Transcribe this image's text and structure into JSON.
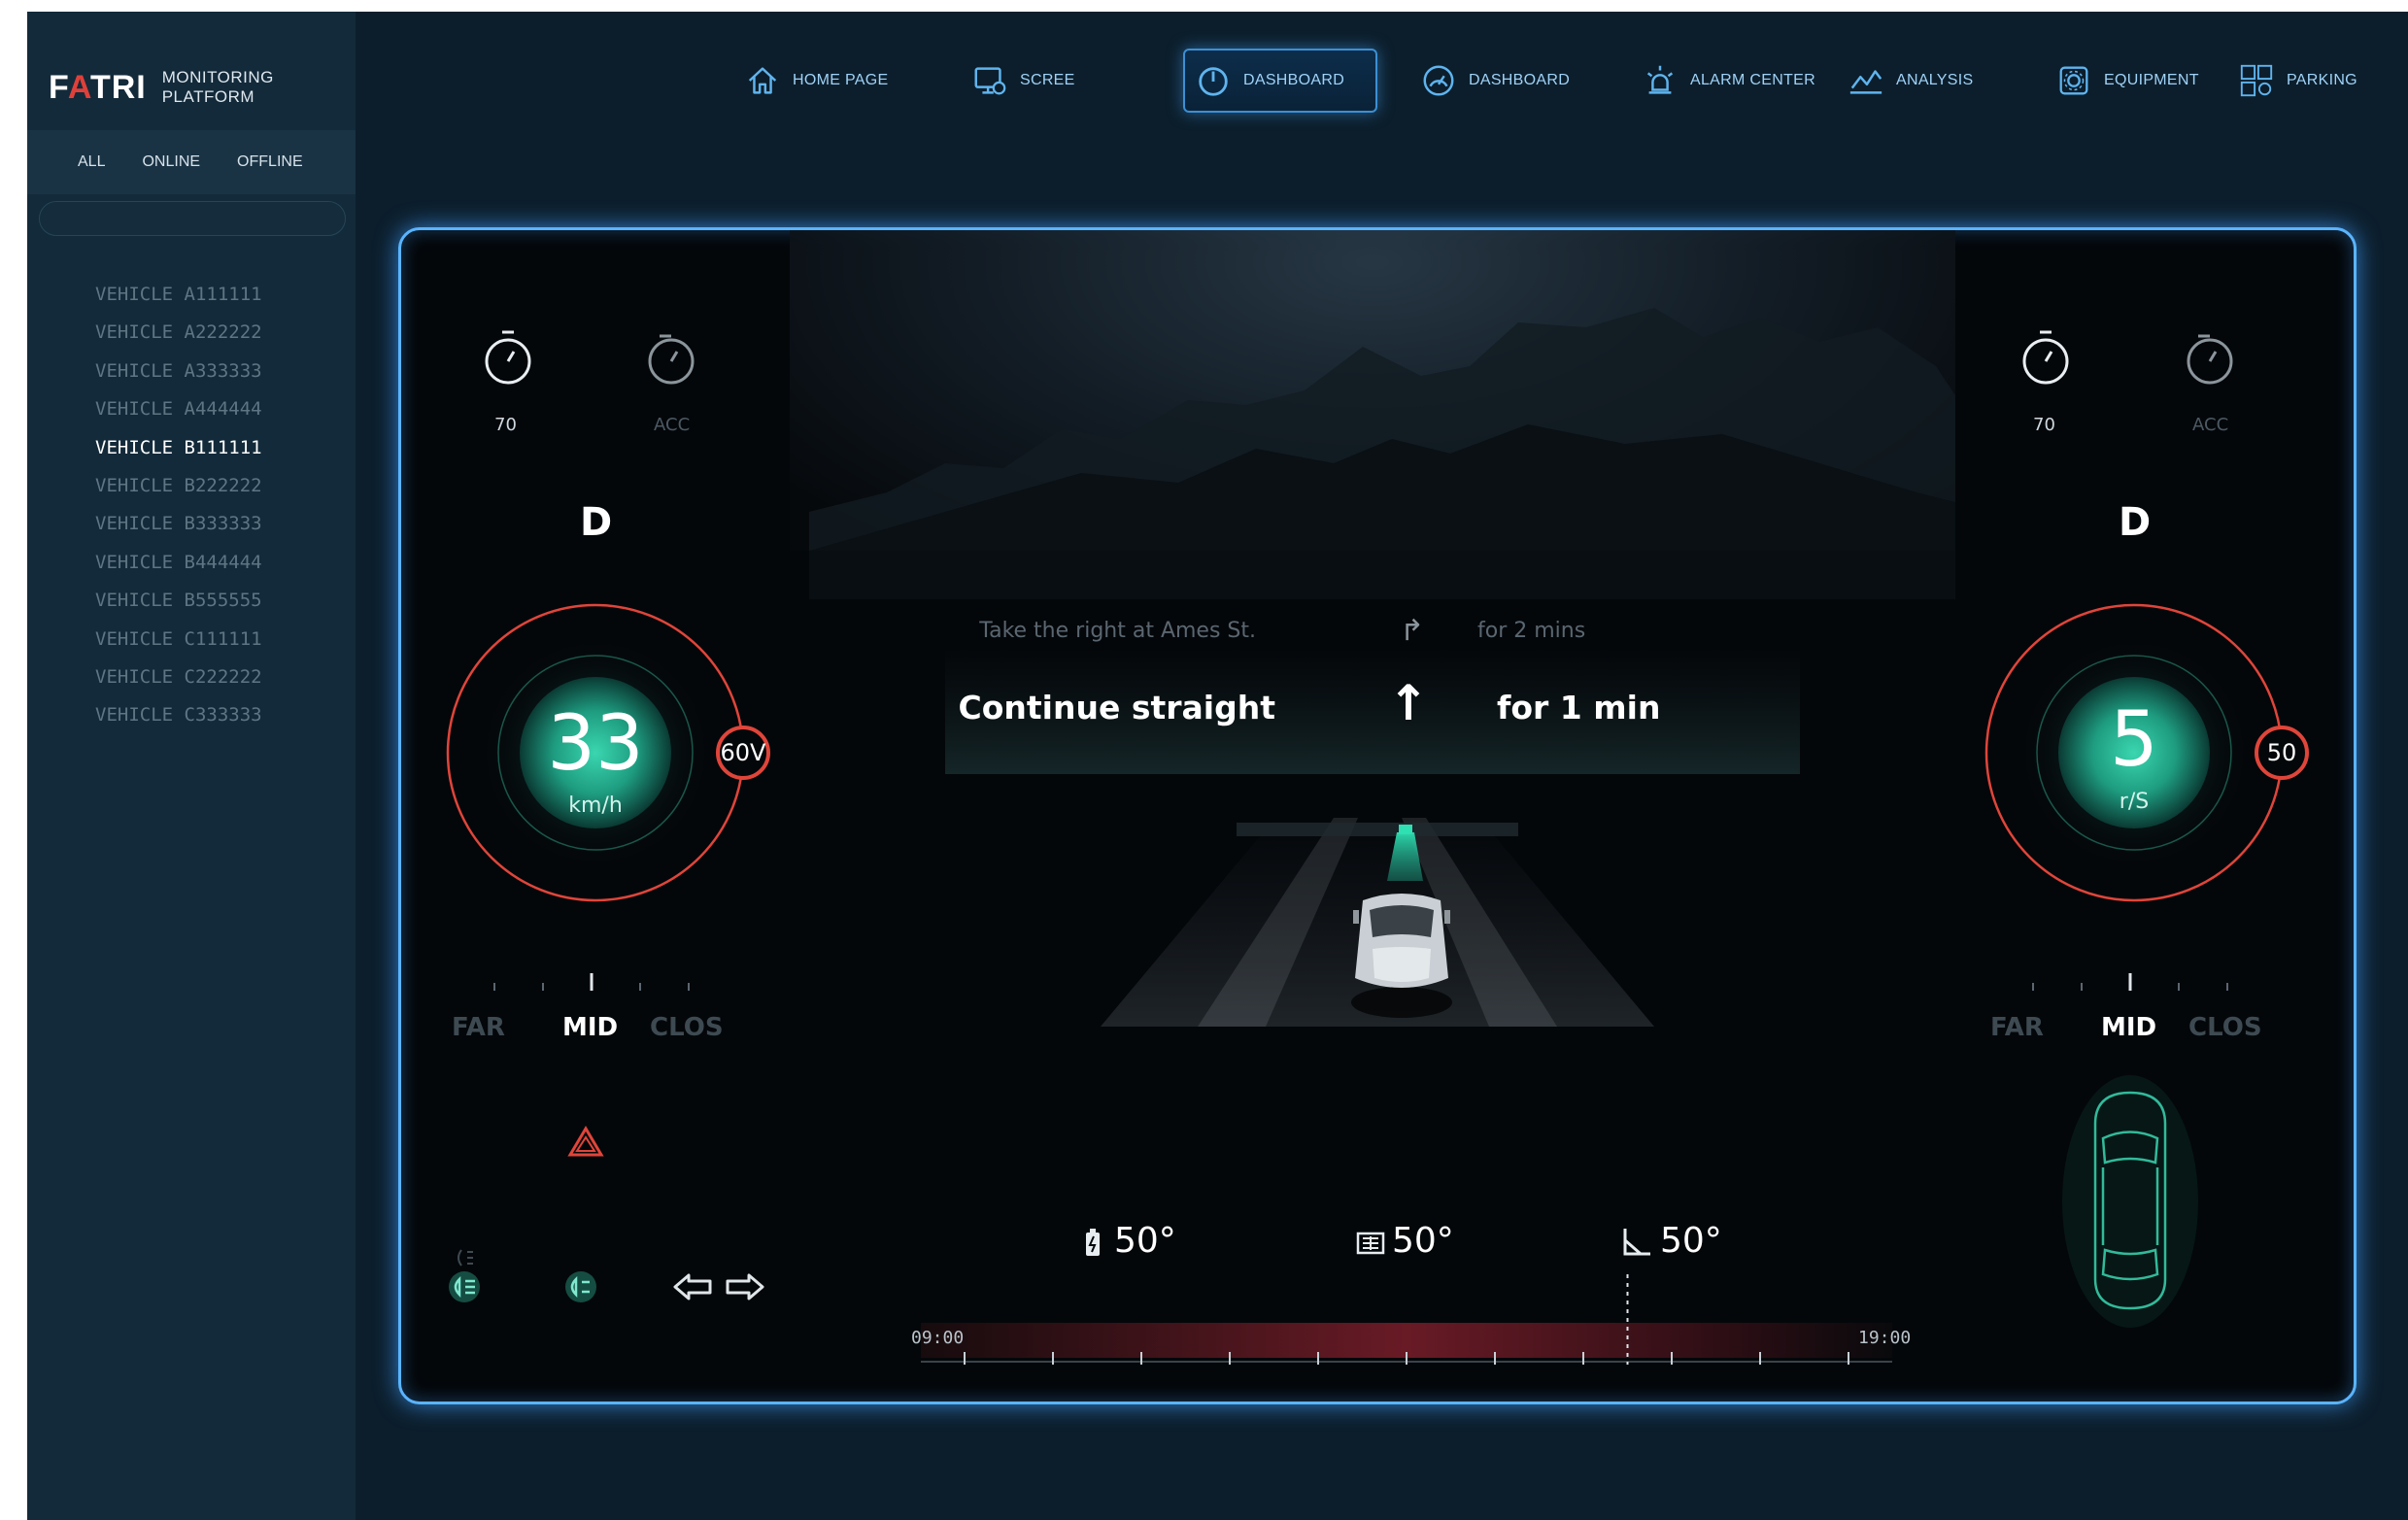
{
  "brand": {
    "logo_pre": "F",
    "logo_accent": "A",
    "logo_post": "TRI",
    "subtitle": "MONITORING PLATFORM"
  },
  "filters": [
    "ALL",
    "ONLINE",
    "OFFLINE"
  ],
  "vehicles": [
    "VEHICLE A111111",
    "VEHICLE A222222",
    "VEHICLE A333333",
    "VEHICLE A444444",
    "VEHICLE B111111",
    "VEHICLE B222222",
    "VEHICLE B333333",
    "VEHICLE B444444",
    "VEHICLE B555555",
    "VEHICLE C111111",
    "VEHICLE C222222",
    "VEHICLE C333333"
  ],
  "active_vehicle_index": 4,
  "nav": [
    {
      "label": "HOME PAGE",
      "icon": "home-icon"
    },
    {
      "label": "SCREE",
      "icon": "monitor-icon"
    },
    {
      "label": "DASHBOARD",
      "icon": "speedometer-icon",
      "active": true
    },
    {
      "label": "DASHBOARD",
      "icon": "gauge-icon"
    },
    {
      "label": "ALARM CENTER",
      "icon": "alarm-icon"
    },
    {
      "label": "ANALYSIS",
      "icon": "line-chart-icon"
    },
    {
      "label": "EQUIPMENT",
      "icon": "gear-icon"
    },
    {
      "label": "PARKING",
      "icon": "parking-icon"
    }
  ],
  "left_cluster": {
    "speed_limit": "70",
    "acc_label": "ACC",
    "gear": "D",
    "value": "33",
    "unit": "km/h",
    "badge": "60V",
    "dist": {
      "far": "FAR",
      "mid": "MID",
      "close": "CLOS"
    }
  },
  "right_cluster": {
    "speed_limit": "70",
    "acc_label": "ACC",
    "gear": "D",
    "value": "5",
    "unit": "r/S",
    "badge": "50",
    "dist": {
      "far": "FAR",
      "mid": "MID",
      "close": "CLOS"
    }
  },
  "navigation": {
    "next": {
      "text": "Take the right at Ames St.",
      "duration": "for 2 mins"
    },
    "current": {
      "text": "Continue straight",
      "duration": "for 1 min"
    }
  },
  "stats": [
    {
      "icon": "battery-icon",
      "value": "50°"
    },
    {
      "icon": "engine-icon",
      "value": "50°"
    },
    {
      "icon": "angle-icon",
      "value": "50°"
    }
  ],
  "timeline": {
    "start": "09:00",
    "end": "19:00",
    "marker_fraction": 0.75
  },
  "colors": {
    "accent_teal": "#33c9a6",
    "ring_red": "#e0453a",
    "frame_glow": "#5ab4ff",
    "nav_text": "#9fd2f7"
  }
}
